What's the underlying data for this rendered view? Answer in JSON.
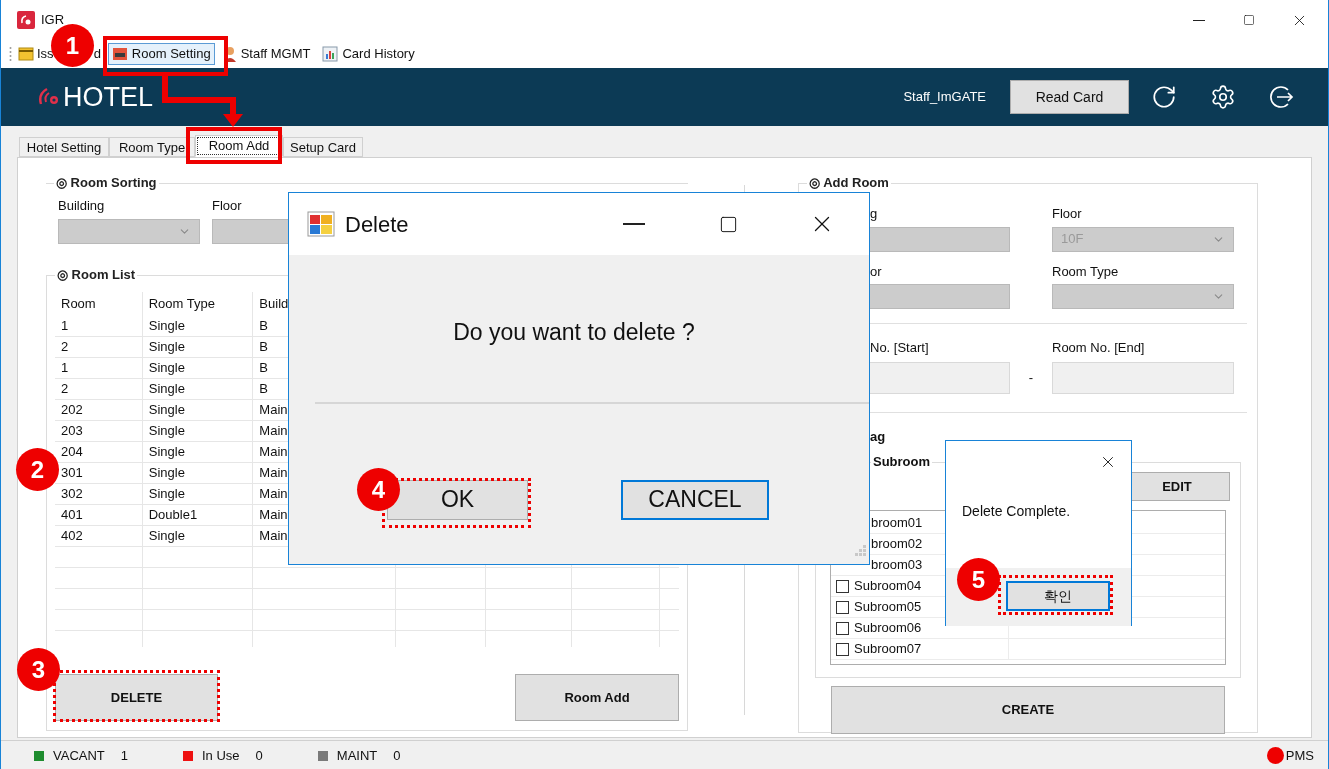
{
  "window": {
    "title": "IGR"
  },
  "toolbar": [
    {
      "kind": "split",
      "label_start": "Iss",
      "label_end": "d",
      "selected": false
    },
    {
      "kind": "full",
      "label": "Room Setting",
      "selected": true
    },
    {
      "kind": "full",
      "label": "Staff MGMT",
      "selected": false
    },
    {
      "kind": "full",
      "label": "Card History",
      "selected": false
    }
  ],
  "header": {
    "logo": "HOTEL",
    "user": "Staff_ImGATE",
    "read_card": "Read Card"
  },
  "tabs": [
    {
      "label": "Hotel Setting",
      "selected": false
    },
    {
      "label": "Room Type",
      "selected": false
    },
    {
      "label": "Room Add",
      "selected": true
    },
    {
      "label": "Setup Card",
      "selected": false
    }
  ],
  "room_sorting": {
    "title": "◎ Room Sorting",
    "fields": [
      {
        "label": "Building"
      },
      {
        "label": "Floor"
      }
    ]
  },
  "room_list": {
    "title": "◎ Room List",
    "columns": [
      "Room",
      "Room Type",
      "Build"
    ],
    "rows": [
      [
        "1",
        "Single",
        "B"
      ],
      [
        "2",
        "Single",
        "B"
      ],
      [
        "1",
        "Single",
        "B"
      ],
      [
        "2",
        "Single",
        "B"
      ],
      [
        "202",
        "Single",
        "Main"
      ],
      [
        "203",
        "Single",
        "Main"
      ],
      [
        "204",
        "Single",
        "Main"
      ],
      [
        "301",
        "Single",
        "Main"
      ],
      [
        "302",
        "Single",
        "Main"
      ],
      [
        "401",
        "Double1",
        "Main"
      ],
      [
        "402",
        "Single",
        "Main"
      ]
    ]
  },
  "delete_button": "DELETE",
  "room_add_button": "Room Add",
  "add_room": {
    "title": "◎ Add Room",
    "fields": [
      {
        "label": "g"
      },
      {
        "label": "Floor",
        "value": "10F"
      },
      {
        "label": "or"
      },
      {
        "label": "Room Type"
      }
    ],
    "room_no": {
      "start_label": "No. [Start]",
      "separator": "-",
      "end_label": "Room No. [End]"
    },
    "tag_label": "ag",
    "subroom": {
      "title": "Subroom",
      "edit": "EDIT",
      "items": [
        {
          "kind": "cut",
          "label": "broom01"
        },
        {
          "kind": "cut",
          "label": "broom02"
        },
        {
          "kind": "cut",
          "label": "broom03"
        },
        {
          "kind": "checkbox",
          "label": "Subroom04",
          "checked": false
        },
        {
          "kind": "checkbox",
          "label": "Subroom05",
          "checked": false
        },
        {
          "kind": "checkbox",
          "label": "Subroom06",
          "checked": false
        },
        {
          "kind": "checkbox",
          "label": "Subroom07",
          "checked": false
        }
      ]
    },
    "create": "CREATE"
  },
  "delete_dialog": {
    "title": "Delete",
    "message": "Do you want to delete ?",
    "ok": "OK",
    "cancel": "CANCEL"
  },
  "complete_dialog": {
    "message": "Delete Complete.",
    "ok": "확인"
  },
  "status_bar": {
    "items": [
      {
        "label": "VACANT",
        "count": "1",
        "color": "#1e8c2e"
      },
      {
        "label": "In Use",
        "count": "0",
        "color": "#ee1111"
      },
      {
        "label": "MAINT",
        "count": "0",
        "color": "#7a7a7a"
      }
    ],
    "pms": "PMS"
  },
  "annotations": [
    {
      "number": "1"
    },
    {
      "number": "2"
    },
    {
      "number": "3"
    },
    {
      "number": "4"
    },
    {
      "number": "5"
    }
  ]
}
